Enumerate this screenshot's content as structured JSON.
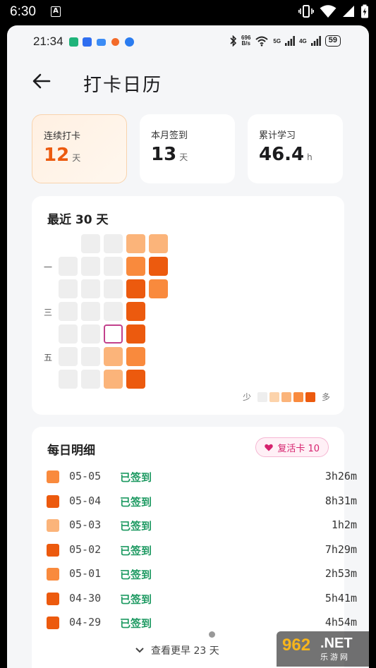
{
  "os_status": {
    "time": "6:30",
    "app_icon_letter": "A"
  },
  "inner_status": {
    "time": "21:34",
    "net_speed_top": "696",
    "net_speed_bottom": "B/s",
    "net1": "5G",
    "net2": "4G",
    "battery": "59"
  },
  "header": {
    "title": "打卡日历"
  },
  "stats": [
    {
      "label": "连续打卡",
      "value": "12",
      "unit": "天",
      "highlight": true
    },
    {
      "label": "本月签到",
      "value": "13",
      "unit": "天",
      "highlight": false
    },
    {
      "label": "累计学习",
      "value": "46.4",
      "unit": "h",
      "highlight": false
    }
  ],
  "heatmap": {
    "title": "最近 30 天",
    "row_labels": [
      "",
      "一",
      "",
      "三",
      "",
      "五",
      ""
    ],
    "legend_min": "少",
    "legend_max": "多",
    "palette": [
      "#eeeeee",
      "#fcd3ab",
      "#fbb47a",
      "#f98a3d",
      "#ec5a0e"
    ],
    "today_outline_color": "#c2418c",
    "columns": [
      [
        null,
        0,
        0,
        0,
        0,
        0,
        0
      ],
      [
        0,
        0,
        0,
        0,
        0,
        0,
        0
      ],
      [
        0,
        0,
        0,
        0,
        "today",
        2,
        2
      ],
      [
        2,
        3,
        4,
        4,
        4,
        3,
        4
      ],
      [
        2,
        4,
        3,
        null,
        null,
        null,
        null
      ]
    ]
  },
  "detail": {
    "title": "每日明细",
    "badge_label": "复活卡 10",
    "status_color": "#1e9a62",
    "rows": [
      {
        "date": "05-05",
        "status": "已签到",
        "duration": "3h26m",
        "level": 3
      },
      {
        "date": "05-04",
        "status": "已签到",
        "duration": "8h31m",
        "level": 4
      },
      {
        "date": "05-03",
        "status": "已签到",
        "duration": "1h2m",
        "level": 2
      },
      {
        "date": "05-02",
        "status": "已签到",
        "duration": "7h29m",
        "level": 4
      },
      {
        "date": "05-01",
        "status": "已签到",
        "duration": "2h53m",
        "level": 3
      },
      {
        "date": "04-30",
        "status": "已签到",
        "duration": "5h41m",
        "level": 4
      },
      {
        "date": "04-29",
        "status": "已签到",
        "duration": "4h54m",
        "level": 4
      }
    ],
    "more_label": "查看更早 23 天"
  },
  "watermark": {
    "text_main": "962",
    "text_net": ".NET",
    "text_sub": "乐游网"
  }
}
